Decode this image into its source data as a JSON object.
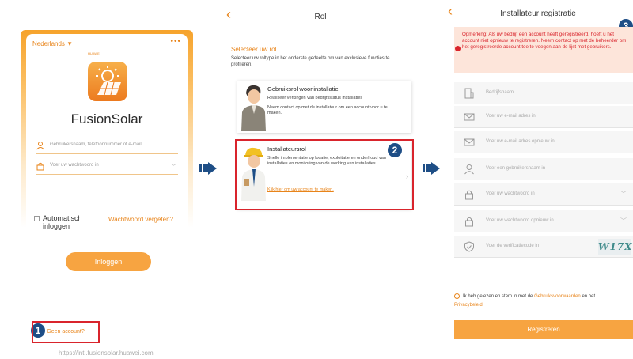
{
  "login": {
    "language": "Nederlands ▼",
    "menu": "•••",
    "brand": "HUAWEI",
    "app_title": "FusionSolar",
    "username_placeholder": "Gebruikersnaam, telefoonnummer of e-mail",
    "password_placeholder": "Voer uw wachtwoord in",
    "auto_login_label": "Automatisch inloggen",
    "forgot_password": "Wachtwoord vergeten?",
    "login_button": "Inloggen",
    "no_account": "Geen account?",
    "step": "1",
    "url": "https://intl.fusionsolar.huawei.com"
  },
  "role": {
    "title": "Rol",
    "select_label": "Selecteer uw rol",
    "description": "Selecteer uw roltype in het onderste gedeelte om van exclusieve functies te profiteren.",
    "step": "2",
    "cards": [
      {
        "title": "Gebruiksrol wooninstallatie",
        "lines": [
          "Realiseer verkingen van bedrijfsstatus installaties",
          "Neem contact op met de installateur om een account voor u te maken."
        ]
      },
      {
        "title": "Installateursrol",
        "lines": [
          "Snelle implementatie op locatie, exploitatie en onderhoud van installaties en monitoring van de werking van installaties"
        ],
        "link": "Klik hier om uw account te maken."
      }
    ]
  },
  "registration": {
    "title": "Installateur registratie",
    "step": "3",
    "notice": "Opmerking: Als uw bedrijf een account heeft geregistreerd, hoeft u het account niet opnieuw te registreren. Neem contact op met de beheerder om het geregistreerde account toe te voegen aan de lijst met gebruikers.",
    "fields": [
      {
        "icon": "company-icon",
        "placeholder": "Bedrijfsnaam"
      },
      {
        "icon": "email-icon",
        "placeholder": "Voer uw e-mail adres in"
      },
      {
        "icon": "email-confirm-icon",
        "placeholder": "Voer uw e-mail adres opnieuw in"
      },
      {
        "icon": "user-icon",
        "placeholder": "Voer een gebruikersnaam in"
      },
      {
        "icon": "lock-icon",
        "placeholder": "Voer uw wachtwoord in"
      },
      {
        "icon": "lock-confirm-icon",
        "placeholder": "Voer uw wachtwoord opnieuw in"
      },
      {
        "icon": "shield-icon",
        "placeholder": "Voer de verificatiecode in"
      }
    ],
    "captcha": "W17X",
    "agree_prefix": "Ik heb gelezen en stem in met de",
    "terms_link": "Gebruiksvoorwaarden",
    "agree_mid": "en het",
    "privacy_link": "Privacybeleid",
    "register_button": "Registreren"
  },
  "colors": {
    "accent": "#f7a441",
    "highlight": "#d9242c",
    "step_badge": "#1e4e86"
  }
}
